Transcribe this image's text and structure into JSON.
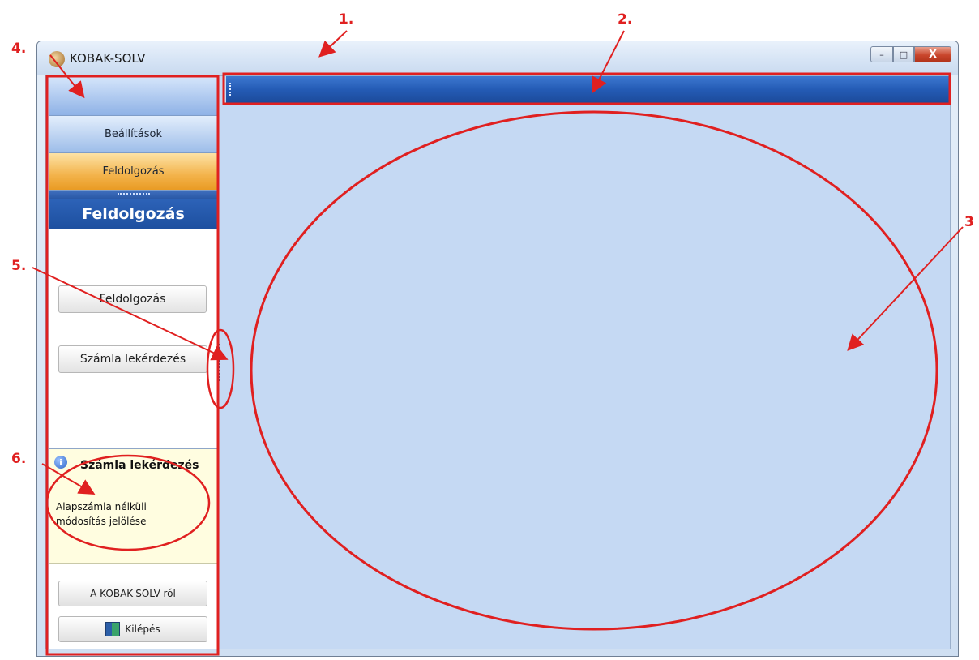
{
  "window": {
    "title": "KOBAK-SOLV",
    "controls": {
      "minimize": "–",
      "maximize": "□",
      "close": "X"
    }
  },
  "sidebar": {
    "nav": [
      {
        "label": ""
      },
      {
        "label": "Beállítások"
      },
      {
        "label": "Feldolgozás",
        "active": true
      }
    ],
    "section_title": "Feldolgozás",
    "actions": [
      "Feldolgozás",
      "Számla lekérdezés"
    ],
    "info": {
      "icon": "info-icon",
      "title": "Számla lekérdezés",
      "text": "Alapszámla nélküli módosítás jelölése"
    },
    "footer": {
      "about": "A KOBAK-SOLV-ról",
      "exit": "Kilépés",
      "exit_icon": "exit-door-icon"
    }
  },
  "annotations": {
    "labels": [
      "1.",
      "2.",
      "3",
      "4.",
      "5.",
      "6."
    ],
    "color": "#e02020"
  },
  "colors": {
    "client_background": "#c5d9f3",
    "top_bar": "#245bb5",
    "active_nav": "#f3b34b",
    "section_header": "#1d4f9f",
    "info_panel": "#fffde0"
  }
}
